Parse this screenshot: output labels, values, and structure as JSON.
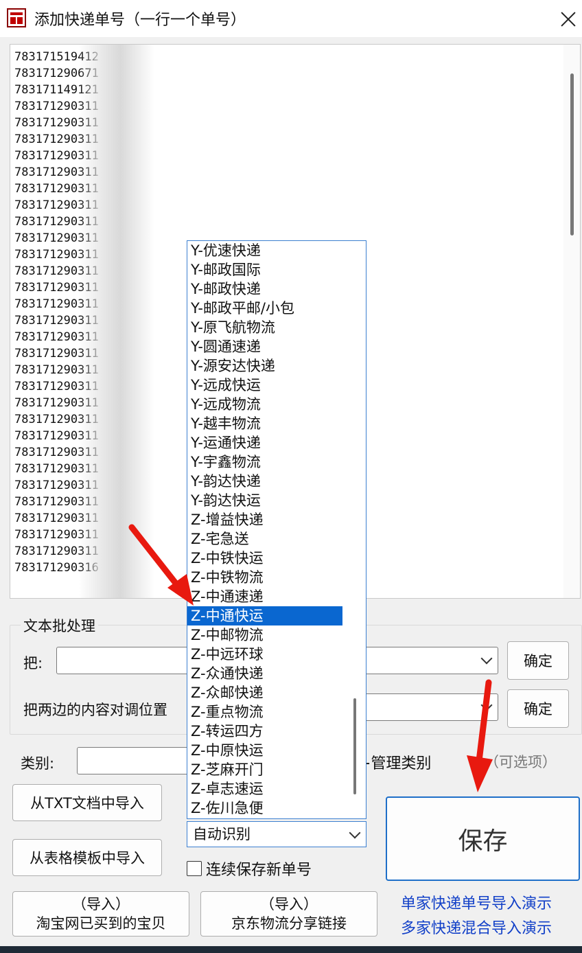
{
  "window": {
    "title": "添加快递单号（一行一个单号）"
  },
  "tracking_numbers": [
    "783171519412",
    "783171290671",
    "783171149121",
    "783171290311",
    "783171290311",
    "783171290311",
    "783171290311",
    "783171290311",
    "783171290311",
    "783171290311",
    "783171290311",
    "783171290311",
    "783171290311",
    "783171290311",
    "783171290311",
    "783171290311",
    "783171290311",
    "783171290311",
    "783171290311",
    "783171290311",
    "783171290311",
    "783171290311",
    "783171290311",
    "783171290311",
    "783171290311",
    "783171290311",
    "783171290311",
    "783171290311",
    "783171290311",
    "783171290311",
    "783171290311",
    "783171290316"
  ],
  "batch": {
    "legend": "文本批处理",
    "replace_label": "把:",
    "swap_label": "把两边的内容对调位置",
    "confirm_label_1": "确定",
    "confirm_label_2": "确定"
  },
  "category": {
    "label": "类别:",
    "manage_label": "+管理类别",
    "optional_label": "（可选项）"
  },
  "import_buttons": {
    "txt": "从TXT文档中导入",
    "template": "从表格模板中导入",
    "taobao_line1": "（导入）",
    "taobao_line2": "淘宝网已买到的宝贝",
    "jd_line1": "（导入）",
    "jd_line2": "京东物流分享链接"
  },
  "courier_dropdown": {
    "selected_value": "自动识别",
    "highlighted_index": 19,
    "options": [
      "Y-优速快递",
      "Y-邮政国际",
      "Y-邮政快递",
      "Y-邮政平邮/小包",
      "Y-原飞航物流",
      "Y-圆通速递",
      "Y-源安达快递",
      "Y-远成快运",
      "Y-远成物流",
      "Y-越丰物流",
      "Y-运通快递",
      "Y-宇鑫物流",
      "Y-韵达快递",
      "Y-韵达快运",
      "Z-增益快递",
      "Z-宅急送",
      "Z-中铁快运",
      "Z-中铁物流",
      "Z-中通速递",
      "Z-中通快运",
      "Z-中邮物流",
      "Z-中远环球",
      "Z-众通快递",
      "Z-众邮快递",
      "Z-重点物流",
      "Z-转运四方",
      "Z-中原快运",
      "Z-芝麻开门",
      "Z-卓志速运",
      "Z-佐川急便"
    ]
  },
  "continuous_save_label": "连续保存新单号",
  "save_label": "保存",
  "demo_links": {
    "single": "单家快递单号导入演示",
    "multi": "多家快递混合导入演示"
  },
  "colors": {
    "accent": "#0a67d0",
    "save_border": "#1e6fc8",
    "link": "#1240c8",
    "annotation_arrow": "#e8190f"
  }
}
